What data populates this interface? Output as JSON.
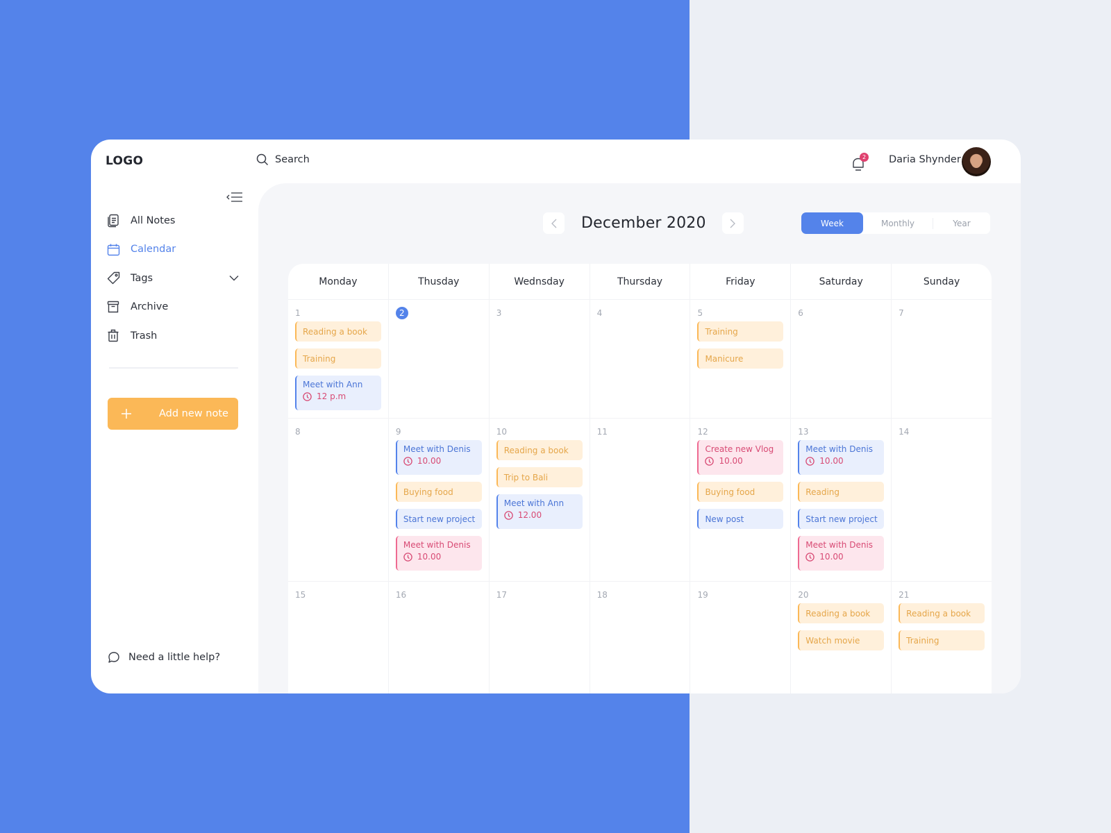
{
  "app": {
    "logo": "LOGO",
    "search": {
      "placeholder": "Search"
    },
    "notifications": {
      "count": "2"
    },
    "user": {
      "name": "Daria Shynder"
    }
  },
  "sidebar": {
    "items": [
      {
        "label": "All Notes",
        "icon": "notes-icon",
        "active": false
      },
      {
        "label": "Calendar",
        "icon": "calendar-icon",
        "active": true
      },
      {
        "label": "Tags",
        "icon": "tag-icon",
        "active": false,
        "expandable": true
      },
      {
        "label": "Archive",
        "icon": "archive-icon",
        "active": false
      },
      {
        "label": "Trash",
        "icon": "trash-icon",
        "active": false
      }
    ],
    "add_note_label": "Add new note",
    "help_label": "Need a little help?"
  },
  "calendar": {
    "month_title": "December 2020",
    "views": [
      {
        "label": "Week",
        "active": true
      },
      {
        "label": "Monthly",
        "active": false
      },
      {
        "label": "Year",
        "active": false
      }
    ],
    "weekdays": [
      "Monday",
      "Thusday",
      "Wednsday",
      "Thursday",
      "Friday",
      "Saturday",
      "Sunday"
    ],
    "colors": {
      "accent": "#5483ea",
      "orange": "#fbb857",
      "pink": "#ee6a91"
    },
    "weeks": [
      [
        {
          "day": "1",
          "events": [
            {
              "title": "Reading a book",
              "color": "orange"
            },
            {
              "title": "Training",
              "color": "orange"
            },
            {
              "title": "Meet with Ann",
              "color": "blue",
              "time": "12 p.m"
            }
          ]
        },
        {
          "day": "2",
          "today": true,
          "events": []
        },
        {
          "day": "3",
          "events": []
        },
        {
          "day": "4",
          "events": []
        },
        {
          "day": "5",
          "events": [
            {
              "title": "Training",
              "color": "orange"
            },
            {
              "title": "Manicure",
              "color": "orange"
            }
          ]
        },
        {
          "day": "6",
          "events": []
        },
        {
          "day": "7",
          "events": []
        }
      ],
      [
        {
          "day": "8",
          "events": []
        },
        {
          "day": "9",
          "events": [
            {
              "title": "Meet with Denis",
              "color": "blue",
              "time": "10.00"
            },
            {
              "title": "Buying food",
              "color": "orange"
            },
            {
              "title": "Start new project",
              "color": "blue"
            },
            {
              "title": "Meet with Denis",
              "color": "pink",
              "time": "10.00"
            }
          ]
        },
        {
          "day": "10",
          "events": [
            {
              "title": "Reading a book",
              "color": "orange"
            },
            {
              "title": "Trip to Bali",
              "color": "orange"
            },
            {
              "title": "Meet with Ann",
              "color": "blue",
              "time": "12.00"
            }
          ]
        },
        {
          "day": "11",
          "events": []
        },
        {
          "day": "12",
          "events": [
            {
              "title": "Create new Vlog",
              "color": "pink",
              "time": "10.00"
            },
            {
              "title": "Buying food",
              "color": "orange"
            },
            {
              "title": "New post",
              "color": "blue"
            }
          ]
        },
        {
          "day": "13",
          "events": [
            {
              "title": "Meet with Denis",
              "color": "blue",
              "time": "10.00"
            },
            {
              "title": "Reading",
              "color": "orange"
            },
            {
              "title": "Start new project",
              "color": "blue"
            },
            {
              "title": "Meet with Denis",
              "color": "pink",
              "time": "10.00"
            }
          ]
        },
        {
          "day": "14",
          "events": []
        }
      ],
      [
        {
          "day": "15",
          "events": []
        },
        {
          "day": "16",
          "events": []
        },
        {
          "day": "17",
          "events": []
        },
        {
          "day": "18",
          "events": []
        },
        {
          "day": "19",
          "events": []
        },
        {
          "day": "20",
          "events": [
            {
              "title": "Reading a book",
              "color": "orange"
            },
            {
              "title": "Watch movie",
              "color": "orange"
            }
          ]
        },
        {
          "day": "21",
          "events": [
            {
              "title": "Reading a book",
              "color": "orange"
            },
            {
              "title": "Training",
              "color": "orange"
            }
          ]
        }
      ]
    ]
  }
}
